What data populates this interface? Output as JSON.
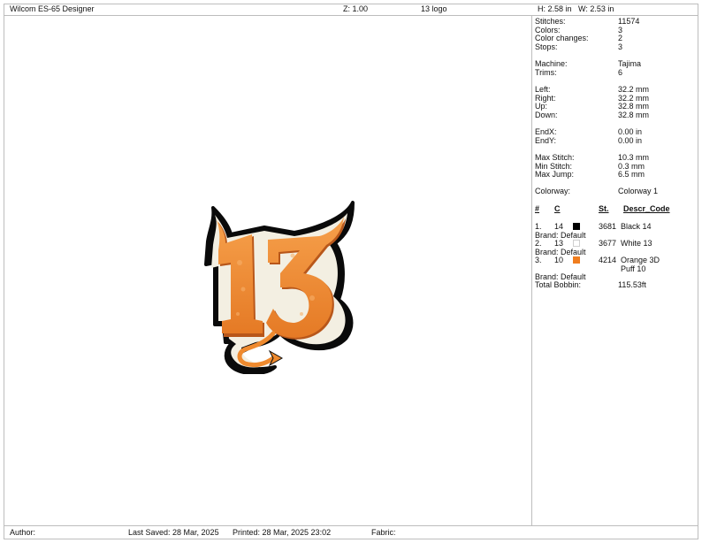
{
  "header": {
    "app": "Wilcom ES-65 Designer",
    "zoom": "Z: 1.00",
    "design_name": "13 logo",
    "height": "H: 2.58 in",
    "width": "W: 2.53 in"
  },
  "stats": [
    {
      "label": "Stitches:",
      "value": "11574"
    },
    {
      "label": "Colors:",
      "value": "3"
    },
    {
      "label": "Color changes:",
      "value": "2"
    },
    {
      "label": "Stops:",
      "value": "3"
    },
    {
      "label": "Machine:",
      "value": "Tajima"
    },
    {
      "label": "Trims:",
      "value": "6"
    },
    {
      "label": "Left:",
      "value": "32.2 mm"
    },
    {
      "label": "Right:",
      "value": "32.2 mm"
    },
    {
      "label": "Up:",
      "value": "32.8 mm"
    },
    {
      "label": "Down:",
      "value": "32.8 mm"
    },
    {
      "label": "EndX:",
      "value": "0.00 in"
    },
    {
      "label": "EndY:",
      "value": "0.00 in"
    },
    {
      "label": "Max Stitch:",
      "value": "10.3 mm"
    },
    {
      "label": "Min Stitch:",
      "value": "0.3 mm"
    },
    {
      "label": "Max Jump:",
      "value": "6.5 mm"
    },
    {
      "label": "Colorway:",
      "value": "Colorway 1"
    }
  ],
  "color_table": {
    "headers": {
      "num": "#",
      "code": "C",
      "st": "St.",
      "desc": "Descr_Code"
    },
    "rows": [
      {
        "num": "1.",
        "code": "14",
        "swatch": "#000000",
        "st": "3681",
        "desc": "Black 14",
        "desc2": "",
        "brand": "Brand: Default"
      },
      {
        "num": "2.",
        "code": "13",
        "swatch": "#ffffff",
        "st": "3677",
        "desc": "White 13",
        "desc2": "",
        "brand": "Brand: Default"
      },
      {
        "num": "3.",
        "code": "10",
        "swatch": "#f07d1e",
        "st": "4214",
        "desc": "Orange 3D",
        "desc2": "Puff 10",
        "brand": "Brand: Default"
      }
    ],
    "total_label": "Total Bobbin:",
    "total_value": "115.53ft"
  },
  "footer": {
    "author": "Author:",
    "last_saved": "Last Saved: 28 Mar, 2025",
    "printed": "Printed: 28 Mar, 2025 23:02",
    "fabric": "Fabric:"
  },
  "design": {
    "text": "13",
    "colors": {
      "outline": "#000000",
      "border": "#f3efe2",
      "fill": "#ef8a2e",
      "shadow": "#b8571a"
    }
  }
}
